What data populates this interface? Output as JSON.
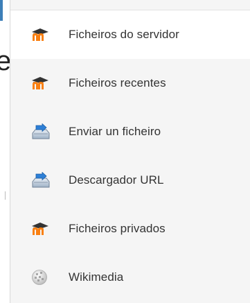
{
  "left_edge": {
    "letter": "e"
  },
  "repositories": [
    {
      "label": "Ficheiros do servidor",
      "icon": "moodle-icon",
      "active": true
    },
    {
      "label": "Ficheiros recentes",
      "icon": "moodle-icon",
      "active": false
    },
    {
      "label": "Enviar un ficheiro",
      "icon": "upload-icon",
      "active": false
    },
    {
      "label": "Descargador URL",
      "icon": "download-icon",
      "active": false
    },
    {
      "label": "Ficheiros privados",
      "icon": "moodle-icon",
      "active": false
    },
    {
      "label": "Wikimedia",
      "icon": "wikimedia-globe-icon",
      "active": false
    }
  ],
  "colors": {
    "moodle_orange": "#f98012",
    "moodle_dark": "#333333",
    "accent_blue": "#3d7fb8",
    "panel_bg": "#f5f5f5",
    "active_bg": "#ffffff"
  }
}
